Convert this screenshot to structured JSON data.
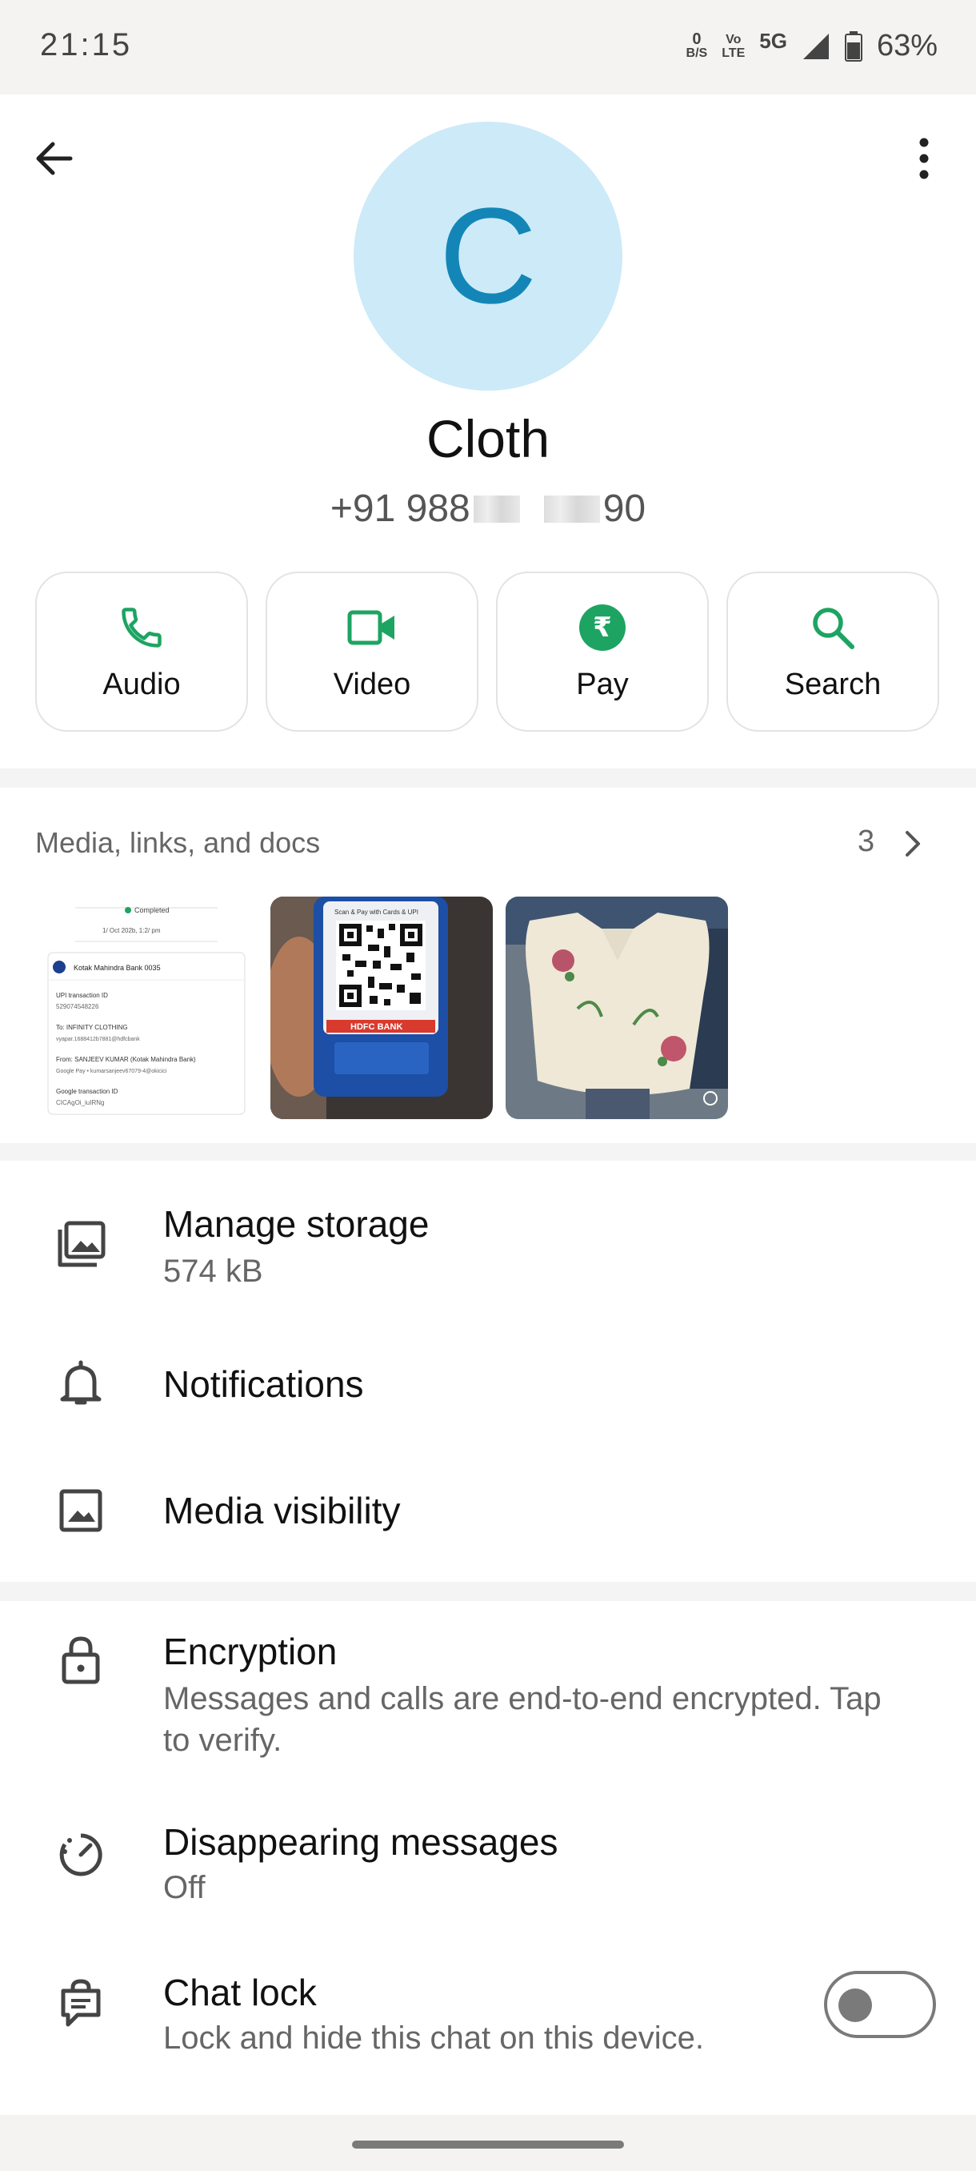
{
  "status_bar": {
    "time": "21:15",
    "net_speed_top": "0",
    "net_speed_unit": "B/S",
    "volte_top": "Vo",
    "volte_bottom": "LTE",
    "network": "5G",
    "battery": "63%"
  },
  "contact": {
    "initial": "C",
    "name": "Cloth",
    "phone_prefix": "+91 988",
    "phone_suffix": "90"
  },
  "actions": [
    {
      "label": "Audio",
      "icon": "phone-icon"
    },
    {
      "label": "Video",
      "icon": "video-icon"
    },
    {
      "label": "Pay",
      "icon": "rupee-icon",
      "symbol": "₹"
    },
    {
      "label": "Search",
      "icon": "search-icon"
    }
  ],
  "media": {
    "title": "Media, links, and docs",
    "count": "3",
    "receipt": {
      "status": "Completed",
      "date": "1/ Oct 202b, 1:2/ pm",
      "bank": "Kotak Mahindra Bank 0035",
      "upi_label": "UPI transaction ID",
      "upi_id": "529074548226",
      "to_label": "To: INFINITY CLOTHING",
      "to_id": "vyapar.1688412b7881@hdfcbank",
      "from_label": "From: SANJEEV  KUMAR (Kotak Mahindra Bank)",
      "from_id": "Google Pay • kumarsanjeev67079-4@okicici",
      "gtxn_label": "Google transaction ID",
      "gtxn_id": "CICAgOi_iuIRNg"
    },
    "qr": {
      "top_text": "Scan & Pay with Cards & UPI",
      "bank_text": "HDFC BANK"
    }
  },
  "settings": {
    "manage_storage": {
      "title": "Manage storage",
      "sub": "574 kB"
    },
    "notifications": {
      "title": "Notifications"
    },
    "media_visibility": {
      "title": "Media visibility"
    },
    "encryption": {
      "title": "Encryption",
      "sub": "Messages and calls are end-to-end encrypted. Tap to verify."
    },
    "disappearing": {
      "title": "Disappearing messages",
      "sub": "Off"
    },
    "chat_lock": {
      "title": "Chat lock",
      "sub": "Lock and hide this chat on this device.",
      "enabled": false
    }
  },
  "colors": {
    "accent_green": "#1da462",
    "avatar_bg": "#cdeaf8",
    "avatar_fg": "#1386b7"
  }
}
